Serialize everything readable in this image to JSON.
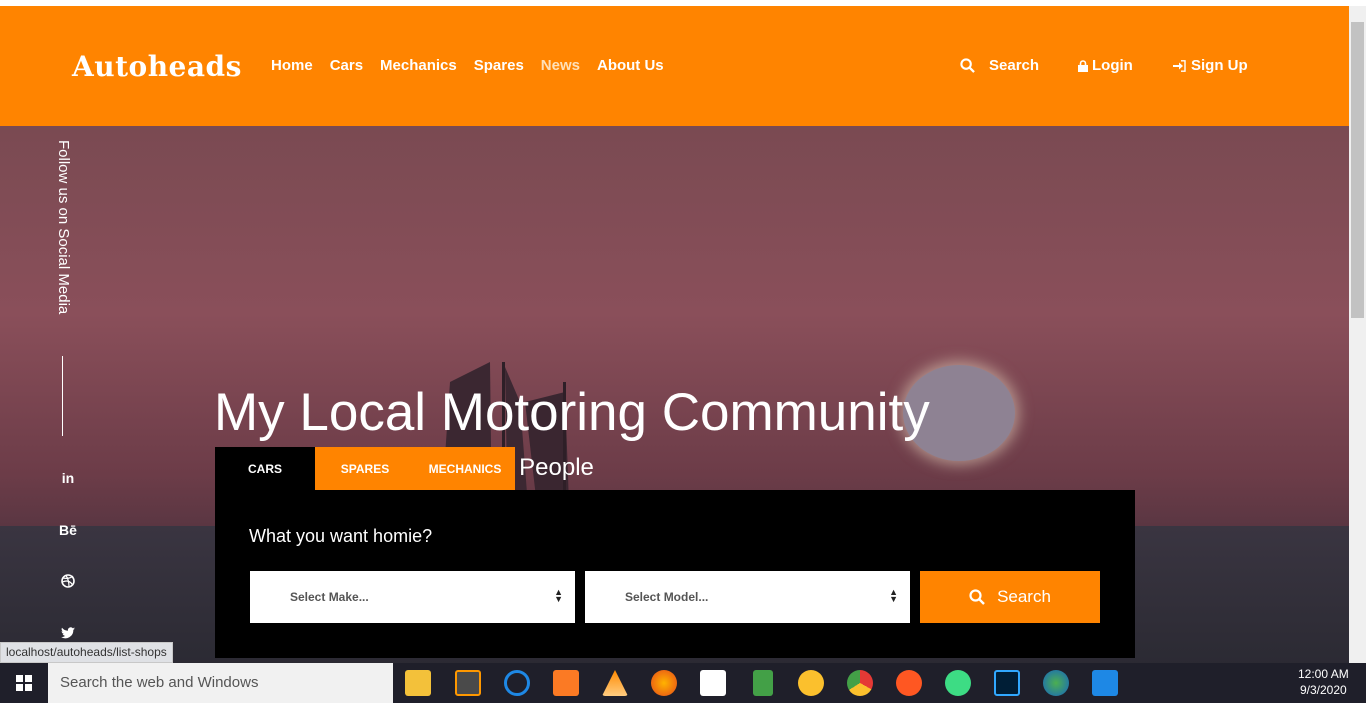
{
  "header": {
    "logo": "Autoheads",
    "nav": [
      {
        "label": "Home"
      },
      {
        "label": "Cars"
      },
      {
        "label": "Mechanics"
      },
      {
        "label": "Spares"
      },
      {
        "label": "News"
      },
      {
        "label": "About Us"
      }
    ],
    "search_label": "Search",
    "login_label": "Login",
    "signup_label": "Sign Up"
  },
  "sidebar": {
    "follow_text": "Follow us on Social Media",
    "socials": [
      {
        "label": "in",
        "icon": "linkedin-icon"
      },
      {
        "label": "Bē",
        "icon": "behance-icon"
      },
      {
        "label": "",
        "icon": "dribbble-icon"
      },
      {
        "label": "",
        "icon": "twitter-icon"
      }
    ]
  },
  "hero": {
    "title": "My Local Motoring Community",
    "subtitle": "Cars | Spares | Mechanics | People"
  },
  "search_panel": {
    "tabs": [
      {
        "label": "CARS"
      },
      {
        "label": "SPARES"
      },
      {
        "label": "MECHANICS"
      }
    ],
    "question": "What you want homie?",
    "make_select": "Select Make...",
    "model_select": "Select Model...",
    "search_button": "Search"
  },
  "status_bar": {
    "url": "localhost/autoheads/list-shops"
  },
  "taskbar": {
    "search_placeholder": "Search the web and Windows",
    "time": "12:00 AM",
    "date": "9/3/2020"
  },
  "colors": {
    "accent": "#ff8400",
    "panel": "#000000"
  }
}
